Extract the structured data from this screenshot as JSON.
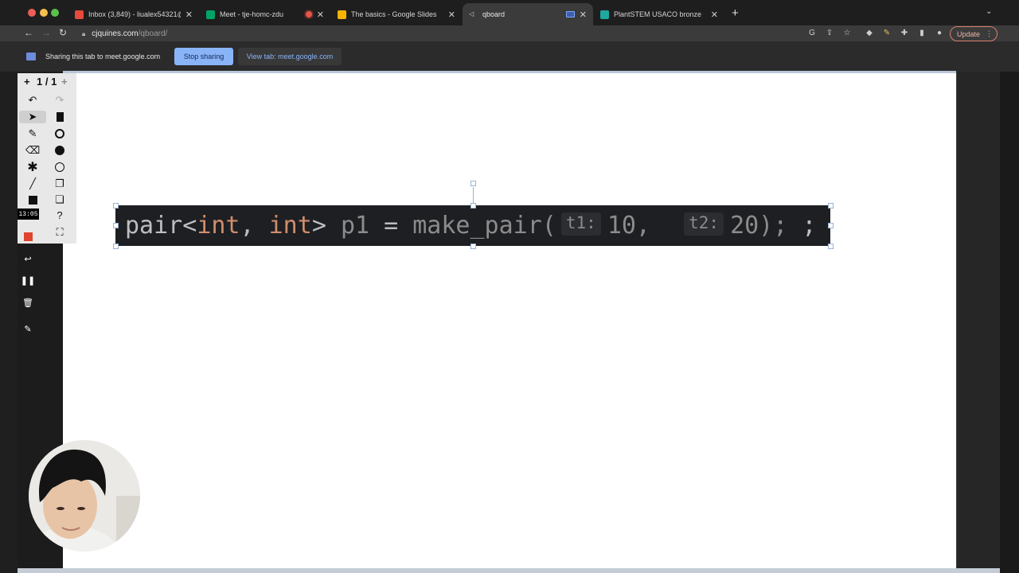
{
  "browser": {
    "tabs": [
      {
        "label": "Inbox (3,849) - liualex54321@",
        "favicon_color": "#e64a3b"
      },
      {
        "label": "Meet - tje-homc-zdu",
        "favicon_color": "#00a467"
      },
      {
        "label": "The basics - Google Slides",
        "favicon_color": "#f6b400"
      },
      {
        "label": "qboard",
        "favicon_color": "#9a9a9a"
      },
      {
        "label": "PlantSTEM USACO bronze",
        "favicon_color": "#1ea8a0"
      }
    ],
    "active_tab_index": 3,
    "new_tab_symbol": "+",
    "url_host": "cjquines.com",
    "url_path": "/qboard/",
    "update_label": "Update",
    "accent_update": "#d9826e"
  },
  "share_bar": {
    "message": "Sharing this tab to meet.google.com",
    "stop_label": "Stop sharing",
    "view_label": "View tab: meet.google.com"
  },
  "qboard": {
    "page_indicator": "1 / 1",
    "page_prev": "+",
    "page_next": "+",
    "tools_left": [
      "undo-icon",
      "select-icon",
      "pen-icon",
      "eraser-icon",
      "laser-icon",
      "line-icon",
      "rectangle-icon"
    ],
    "tools_right": [
      "redo-icon",
      "file-icon",
      "circle-outline-icon",
      "circle-filled-icon",
      "circle-thin-icon",
      "copy-icon",
      "paste-icon",
      "help-icon",
      "fullscreen-icon"
    ],
    "help_symbol": "?"
  },
  "recorder": {
    "timer": "13:05",
    "controls": [
      "record-stop-icon",
      "undo-icon",
      "pause-icon",
      "trash-icon",
      "pen-icon"
    ]
  },
  "code": {
    "tokens": [
      {
        "text": "pair",
        "cls": "tok-w"
      },
      {
        "text": "<",
        "cls": "tok-w"
      },
      {
        "text": "int",
        "cls": "tok-k"
      },
      {
        "text": ", ",
        "cls": "tok-w"
      },
      {
        "text": "int",
        "cls": "tok-k"
      },
      {
        "text": "> ",
        "cls": "tok-w"
      },
      {
        "text": "p1",
        "cls": "tok-d"
      },
      {
        "text": " = ",
        "cls": "tok-w"
      },
      {
        "text": "make_pair(",
        "cls": "tok-d"
      },
      {
        "hint": "t1:"
      },
      {
        "text": "10,  ",
        "cls": "tok-d"
      },
      {
        "hint": "t2:"
      },
      {
        "text": "20);",
        "cls": "tok-d"
      },
      {
        "text": " ;",
        "cls": "tok-w"
      }
    ]
  }
}
